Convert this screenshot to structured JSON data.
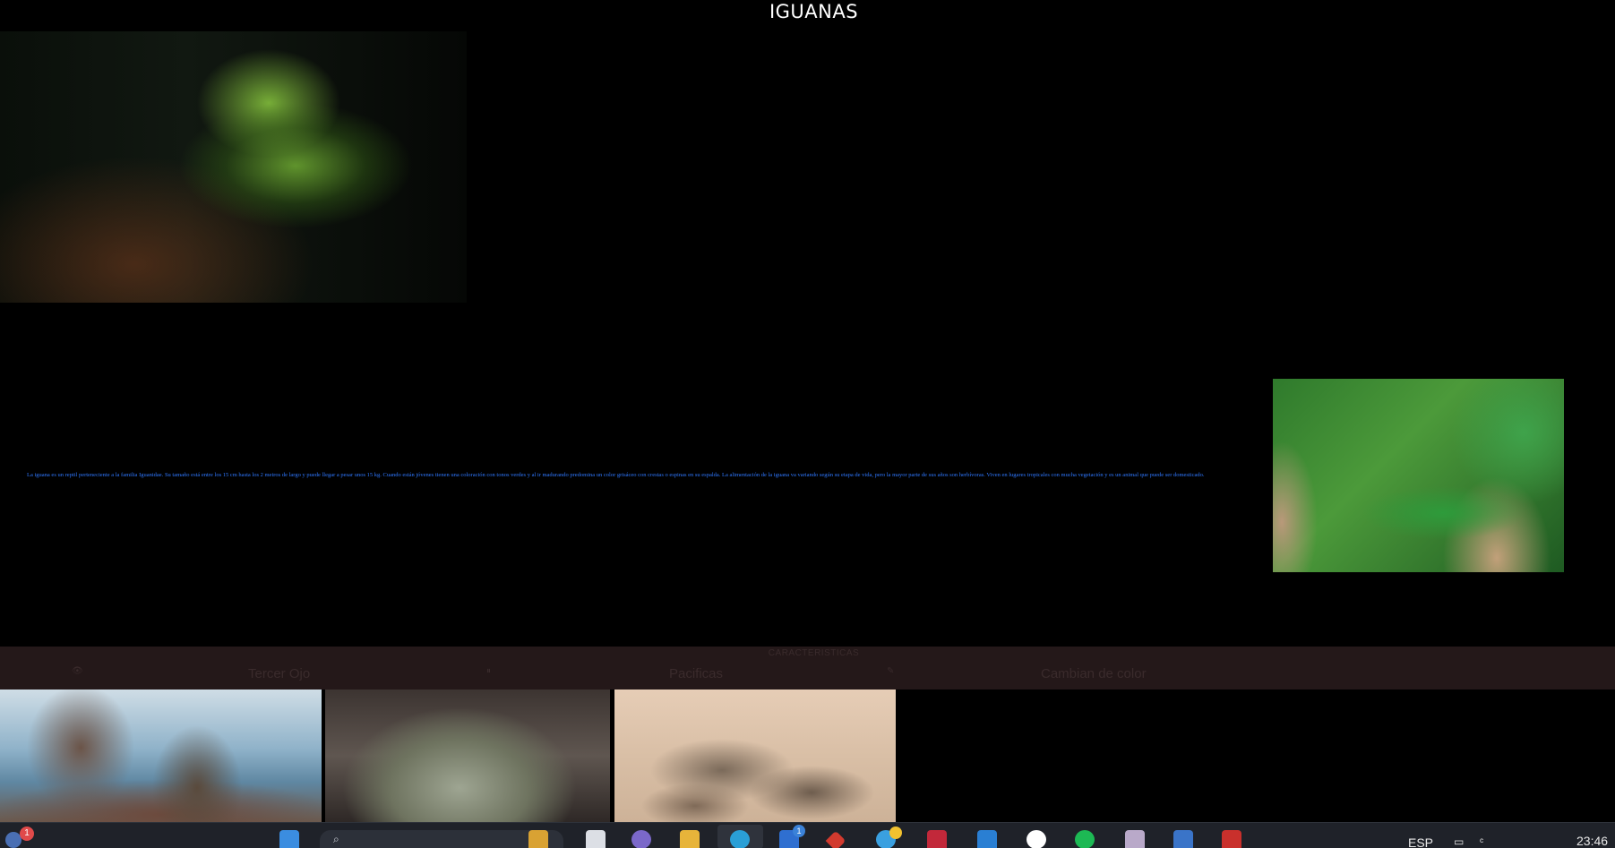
{
  "page": {
    "title": "IGUANAS",
    "description": "La iguana es un reptil perteneciente a la familia Iguanidae. Su tamaño está entre los 15 cm hasta los 2 metros de largo y puede llegar a pesar unos 15 kg. Cuando están jóvenes tienen una coloración con tonos verdes y al ir madurando predomina un color grisáceo con crestas o espinas en su espalda. La alimentación de la iguana va variando según su etapa de vida, pero la mayor parte de sus años son herbívoras. Viven en lugares tropicales con mucha vegetación y es un animal que puede ser domesticado."
  },
  "features": {
    "title": "CARACTERISTICAS",
    "items": [
      {
        "icon": "eye-icon",
        "label": "Tercer Ojo",
        "glyph": "👁"
      },
      {
        "icon": "pause-icon",
        "label": "Pacificas",
        "glyph": "⏸"
      },
      {
        "icon": "brush-icon",
        "label": "Cambian de color",
        "glyph": "✎"
      }
    ]
  },
  "taskbar": {
    "notification_count": "1",
    "outlook_badge": "1",
    "language": "ESP",
    "time": "23:46",
    "accent_colors": {
      "start": "#3b8de0",
      "notify": "#e04a4a"
    }
  },
  "colors": {
    "background": "#000000",
    "description_text": "#2f78ff",
    "features_bar": "#241819"
  }
}
